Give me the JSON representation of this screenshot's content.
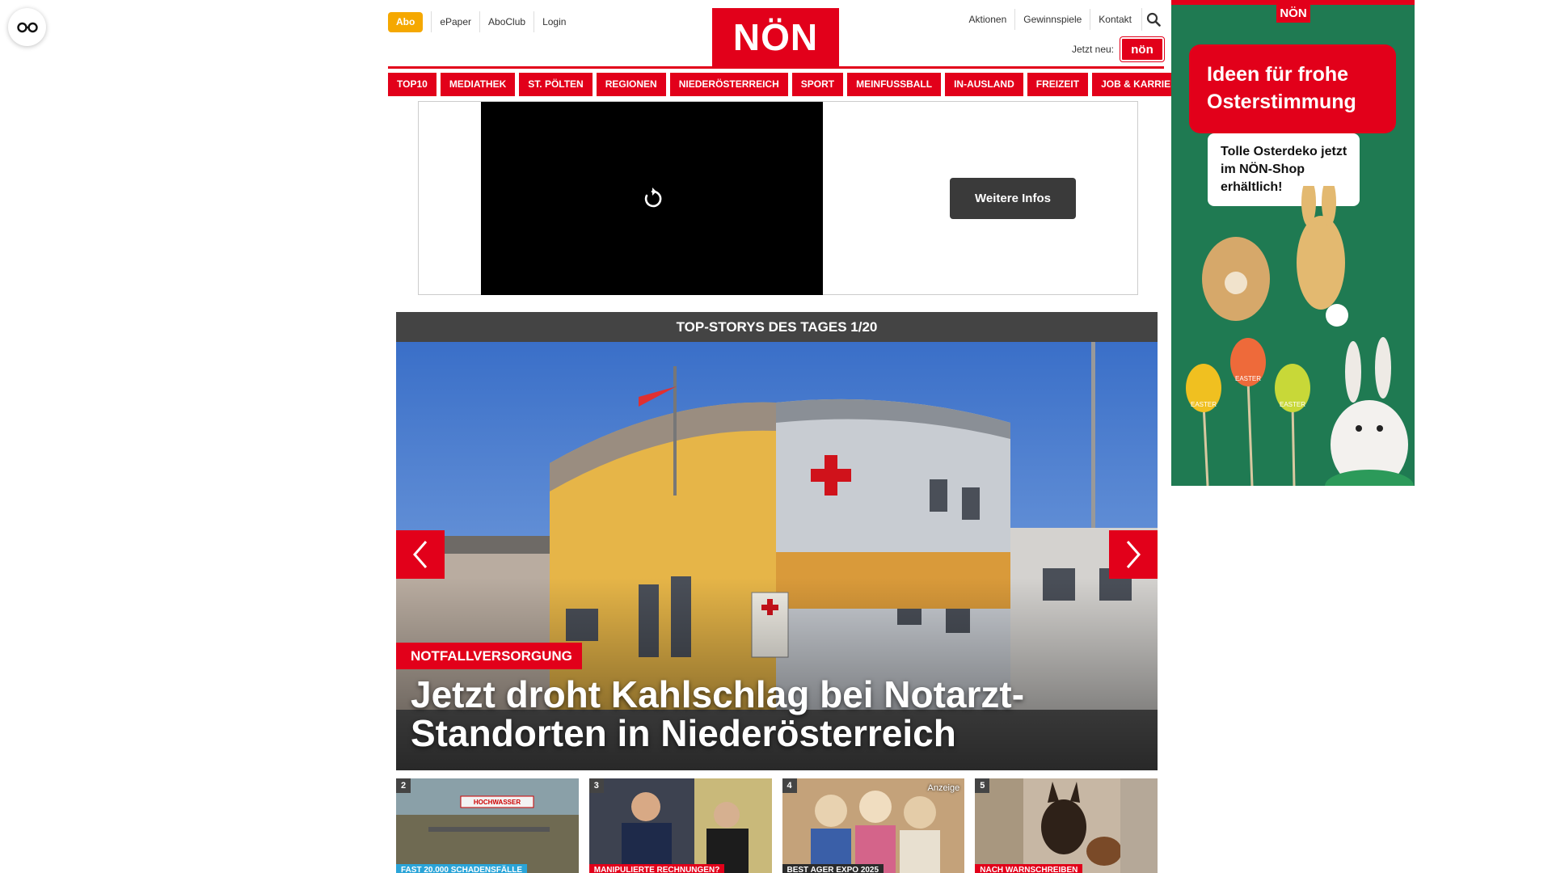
{
  "header": {
    "abo_label": "Abo",
    "left_links": [
      "ePaper",
      "AboClub",
      "Login"
    ],
    "logo_text": "NÖN",
    "right_links": [
      "Aktionen",
      "Gewinnspiele",
      "Kontakt"
    ],
    "jetzt_neu_label": "Jetzt neu:",
    "jetzt_neu_badge": "nön"
  },
  "nav": {
    "items": [
      "TOP10",
      "MEDIATHEK",
      "ST. PÖLTEN",
      "REGIONEN",
      "NIEDERÖSTERREICH",
      "SPORT",
      "MEINFUSSBALL",
      "IN-AUSLAND",
      "FREIZEIT",
      "JOB & KARRIERE"
    ]
  },
  "video_ad": {
    "button_label": "Weitere Infos"
  },
  "top_stories": {
    "heading": "TOP-STORYS DES TAGES 1/20",
    "hero": {
      "kicker": "NOTFALLVERSORGUNG",
      "title": "Jetzt droht Kahlschlag bei Notarzt-Standorten in Niederösterreich"
    },
    "thumbs": [
      {
        "num": "2",
        "label": "FAST 20.000 SCHADENSFÄLLE",
        "label_color": "#2aa4d8",
        "sign": "HOCHWASSER"
      },
      {
        "num": "3",
        "label": "MANIPULIERTE RECHNUNGEN?",
        "label_color": "#e2001a"
      },
      {
        "num": "4",
        "label": "BEST AGER EXPO 2025",
        "label_color": "#2b2b2b",
        "anzeige": "Anzeige"
      },
      {
        "num": "5",
        "label": "NACH WARNSCHREIBEN",
        "label_color": "#e2001a"
      }
    ]
  },
  "side_ad": {
    "logo": "NÖN",
    "headline": "Ideen für frohe Osterstimmung",
    "sub": "Tolle Osterdeko jetzt im NÖN-Shop erhältlich!",
    "egg_text": "EASTER"
  },
  "colors": {
    "brand_red": "#e2001a",
    "abo_orange": "#f5a800",
    "ad_green": "#1f7a52"
  }
}
